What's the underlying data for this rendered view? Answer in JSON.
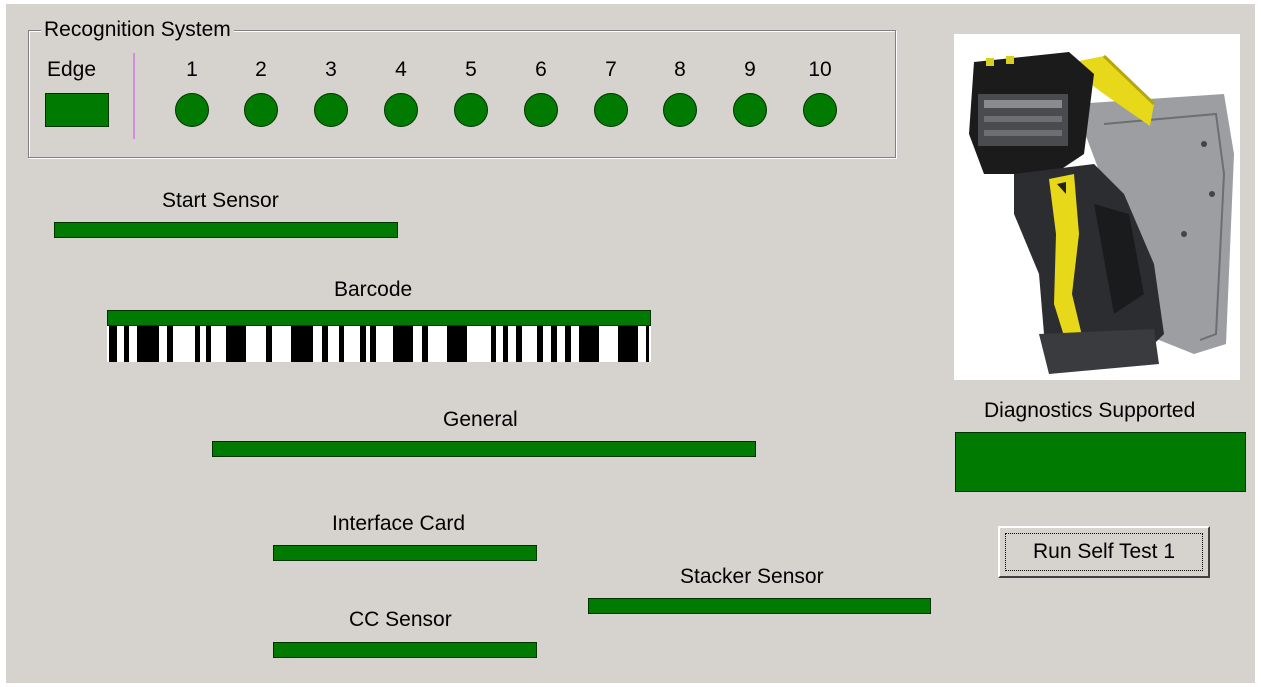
{
  "recognition": {
    "title": "Recognition System",
    "edge_label": "Edge",
    "channels": [
      "1",
      "2",
      "3",
      "4",
      "5",
      "6",
      "7",
      "8",
      "9",
      "10"
    ]
  },
  "sensors": {
    "start_sensor": "Start Sensor",
    "barcode": "Barcode",
    "general": "General",
    "interface_card": "Interface Card",
    "stacker_sensor": "Stacker Sensor",
    "cc_sensor": "CC Sensor"
  },
  "diagnostics": {
    "label": "Diagnostics Supported"
  },
  "actions": {
    "self_test_label": "Run Self Test 1"
  },
  "colors": {
    "indicator_on": "#007a00",
    "panel_bg": "#d6d3ce",
    "divider": "#d08fd8"
  }
}
